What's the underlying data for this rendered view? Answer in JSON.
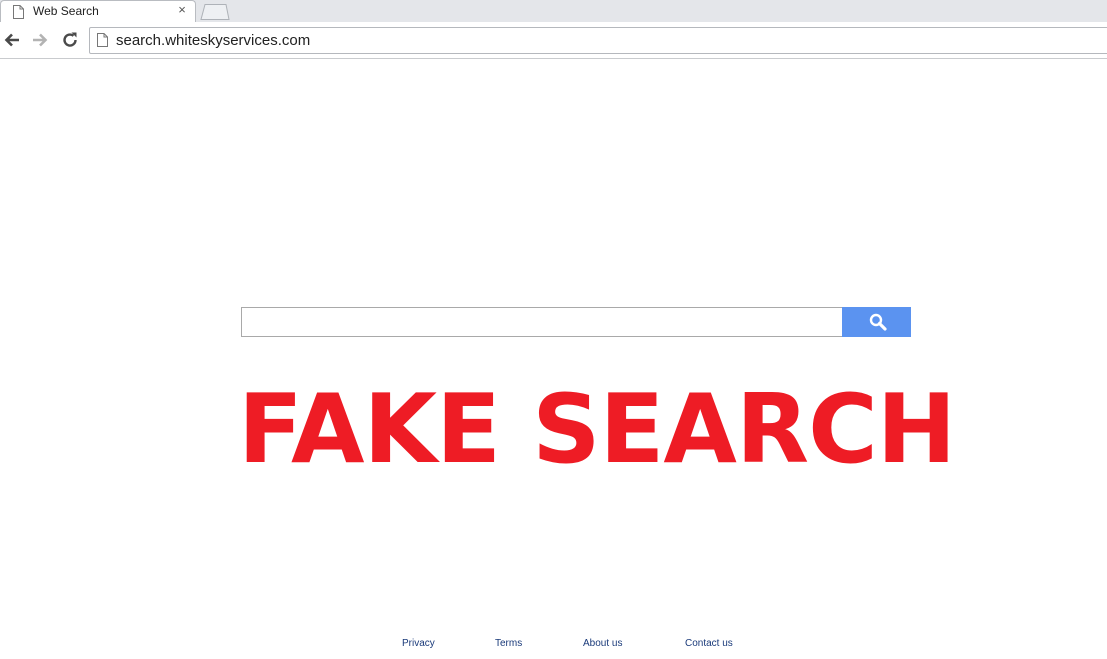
{
  "browser": {
    "tab_title": "Web Search",
    "close_glyph": "×",
    "url": "search.whiteskyservices.com"
  },
  "search": {
    "placeholder": "",
    "value": "",
    "button_icon": "search-icon",
    "button_color": "#5b93f0"
  },
  "overlay": {
    "text": "FAKE SEARCH",
    "color": "#ee1c25"
  },
  "footer": {
    "links": [
      "Privacy",
      "Terms",
      "About us",
      "Contact us"
    ]
  }
}
